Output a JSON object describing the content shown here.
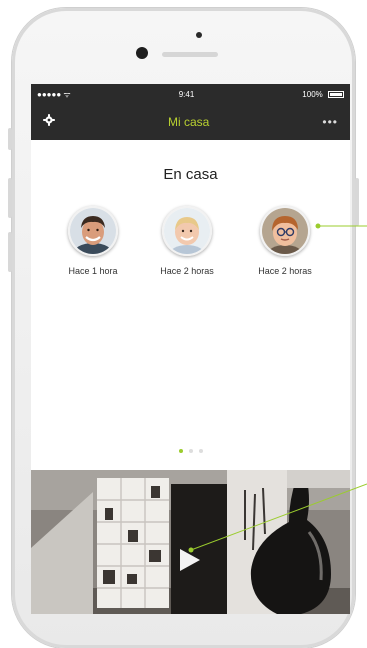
{
  "status_bar": {
    "carrier": "●●●●● ᯤ",
    "time": "9:41",
    "battery_pct": "100%",
    "battery_level": 1.0
  },
  "nav": {
    "title": "Mi casa",
    "more_label": "•••"
  },
  "home": {
    "title": "En casa",
    "profiles": [
      {
        "label": "Hace 1 hora"
      },
      {
        "label": "Hace 2 horas"
      },
      {
        "label": "Hace 2 horas"
      }
    ]
  },
  "pager": {
    "count": 3,
    "active": 0
  },
  "colors": {
    "accent": "#b8d030",
    "dot_active": "#9bcc2e",
    "bar": "#2b2b2b",
    "annotation_line": "#9bcc2e"
  },
  "icons": {
    "settings": "gear-icon",
    "play": "play-icon"
  }
}
